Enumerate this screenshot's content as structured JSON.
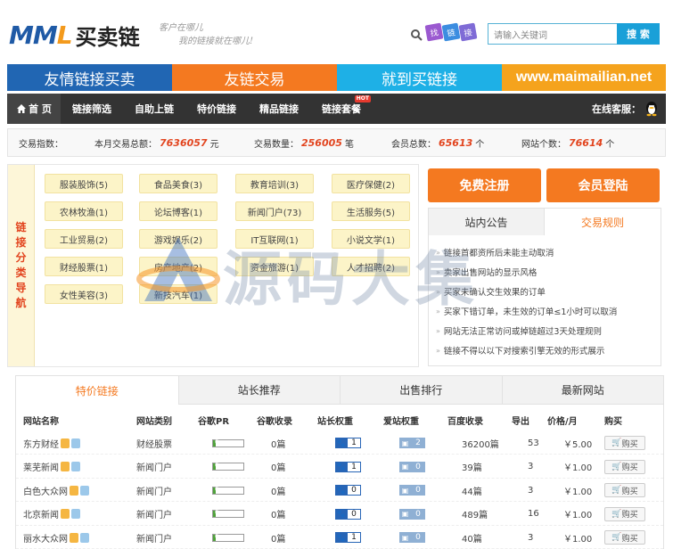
{
  "header": {
    "logo_latin": "MML",
    "logo_cn": "买卖链",
    "slogan_line1": "客户在哪儿",
    "slogan_line2": "我的链接就在哪儿!",
    "tags": [
      "找",
      "链",
      "接"
    ],
    "search_placeholder": "请输入关键词",
    "search_button": "搜 索"
  },
  "banner": [
    "友情链接买卖",
    "友链交易",
    "就到买链接",
    "www.maimailian.net"
  ],
  "nav": {
    "items": [
      "首 页",
      "链接筛选",
      "自助上链",
      "特价链接",
      "精品链接",
      "链接套餐"
    ],
    "hot_badge": "HOT",
    "service": "在线客服："
  },
  "stats": {
    "index_label": "交易指数：",
    "monthly_label": "本月交易总额：",
    "monthly_value": "7636057",
    "monthly_unit": "元",
    "count_label": "交易数量：",
    "count_value": "256005",
    "count_unit": "笔",
    "members_label": "会员总数：",
    "members_value": "65613",
    "members_unit": "个",
    "sites_label": "网站个数：",
    "sites_value": "76614",
    "sites_unit": "个"
  },
  "categories": {
    "side_title": [
      "链",
      "接",
      "分",
      "类",
      "导",
      "航"
    ],
    "items": [
      "服装股饰(5)",
      "食品美食(3)",
      "教育培训(3)",
      "医疗保健(2)",
      "农林牧渔(1)",
      "论坛博客(1)",
      "新闻门户(73)",
      "生活服务(5)",
      "工业贸易(2)",
      "游戏娱乐(2)",
      "IT互联网(1)",
      "小说文学(1)",
      "财经股票(1)",
      "房产地产(2)",
      "资金旅游(1)",
      "人才招聘(2)",
      "女性美容(3)",
      "新技汽车(1)"
    ]
  },
  "side": {
    "register": "免费注册",
    "login": "会员登陆",
    "tab_notice": "站内公告",
    "tab_rules": "交易规则",
    "rules": [
      "链接首都资所后未能主动取消",
      "卖家出售网站的显示风格",
      "买家未确认交生效果的订单",
      "买家下错订单，未生效的订单≤1小时可以取消",
      "网站无法正常访问或掉链超过3天处理规则",
      "链接不得以以下对搜索引擎无效的形式展示"
    ]
  },
  "listing": {
    "tabs": [
      "特价链接",
      "站长推荐",
      "出售排行",
      "最新网站"
    ],
    "headers": [
      "网站名称",
      "网站类别",
      "谷歌PR",
      "谷歌收录",
      "站长权重",
      "爱站权重",
      "百度收录",
      "导出",
      "价格/月",
      "购买"
    ],
    "buy_label": "购买",
    "rows": [
      {
        "name": "东方财经",
        "category": "财经股票",
        "pr": "0",
        "pr_fill": 0.1,
        "google": "0篇",
        "zz": "1",
        "az": "2",
        "baidu": "36200篇",
        "out": "53",
        "price": "￥5.00"
      },
      {
        "name": "莱芜新闻",
        "category": "新闻门户",
        "pr": "0",
        "pr_fill": 0.1,
        "google": "0篇",
        "zz": "1",
        "az": "0",
        "baidu": "39篇",
        "out": "3",
        "price": "￥1.00"
      },
      {
        "name": "白色大众网",
        "category": "新闻门户",
        "pr": "0",
        "pr_fill": 0.1,
        "google": "0篇",
        "zz": "0",
        "az": "0",
        "baidu": "44篇",
        "out": "3",
        "price": "￥1.00"
      },
      {
        "name": "北京新闻",
        "category": "新闻门户",
        "pr": "0",
        "pr_fill": 0.1,
        "google": "0篇",
        "zz": "0",
        "az": "0",
        "baidu": "489篇",
        "out": "16",
        "price": "￥1.00"
      },
      {
        "name": "丽水大众网",
        "category": "新闻门户",
        "pr": "0",
        "pr_fill": 0.1,
        "google": "0篇",
        "zz": "1",
        "az": "0",
        "baidu": "40篇",
        "out": "3",
        "price": "￥1.00"
      }
    ]
  },
  "watermark": "源码大集"
}
